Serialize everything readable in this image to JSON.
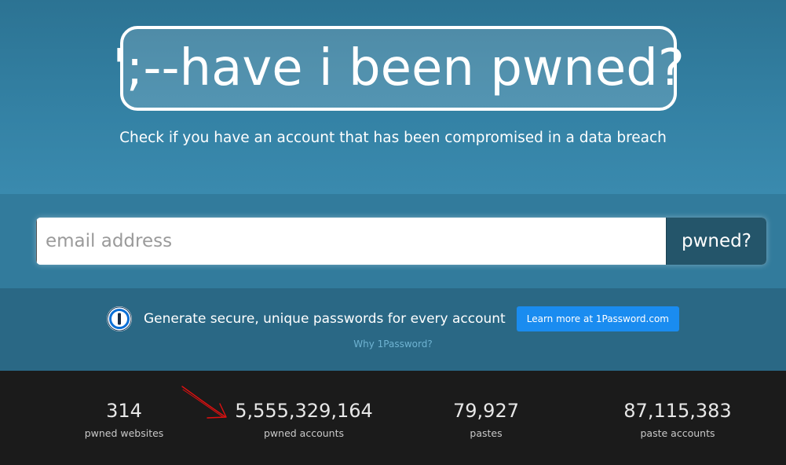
{
  "hero": {
    "logo_text": "';--have i been pwned?",
    "tagline": "Check if you have an account that has been compromised in a data breach"
  },
  "search": {
    "placeholder": "email address",
    "value": "",
    "button_label": "pwned?"
  },
  "promo": {
    "icon": "1password-icon",
    "text": "Generate secure, unique passwords for every account",
    "button_label": "Learn more at 1Password.com",
    "link_text": "Why 1Password?"
  },
  "stats": [
    {
      "value": "314",
      "label": "pwned websites"
    },
    {
      "value": "5,555,329,164",
      "label": "pwned accounts"
    },
    {
      "value": "79,927",
      "label": "pastes"
    },
    {
      "value": "87,115,383",
      "label": "paste accounts"
    }
  ],
  "annotation": {
    "icon": "red-arrow-icon",
    "color": "#e01010"
  },
  "colors": {
    "hero": "#2e7a9b",
    "button": "#24556a",
    "promo_button": "#1a8cf0",
    "stats_bg": "#1b1b1b"
  }
}
